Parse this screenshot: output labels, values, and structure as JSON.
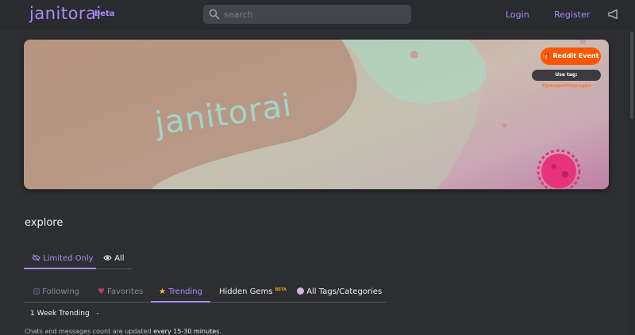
{
  "header": {
    "logo": "janitorai",
    "logo_badge": "beta",
    "search_placeholder": "search",
    "login_label": "Login",
    "register_label": "Register"
  },
  "banner": {
    "wordmark": "janitorai",
    "event_button": "Reddit Event",
    "tag_prefix": "Use tag: ",
    "tag_value": "#passporttopages"
  },
  "section_title": "explore",
  "filter_tabs": [
    {
      "label": "Limited Only",
      "icon": "eye-slash-icon",
      "active": true
    },
    {
      "label": "All",
      "icon": "eye-icon",
      "active": false
    }
  ],
  "category_tabs": [
    {
      "label": "Following",
      "icon": "following-icon"
    },
    {
      "label": "Favorites",
      "icon": "heart-icon"
    },
    {
      "label": "Trending",
      "icon": "star-icon",
      "active": true
    },
    {
      "label": "Hidden Gems",
      "badge": "BETA"
    },
    {
      "label": "All Tags/Categories",
      "icon": "tag-circle-icon"
    }
  ],
  "trending_range": "1 Week Trending",
  "dropdown_caret": "-",
  "info_prefix": "Chats and messages count are updated ",
  "info_emphasis": "every 15-30 minutes",
  "info_suffix": ".",
  "colors": {
    "accent": "#a78bfa",
    "reddit": "#ff5700",
    "background": "#2d2e32"
  }
}
